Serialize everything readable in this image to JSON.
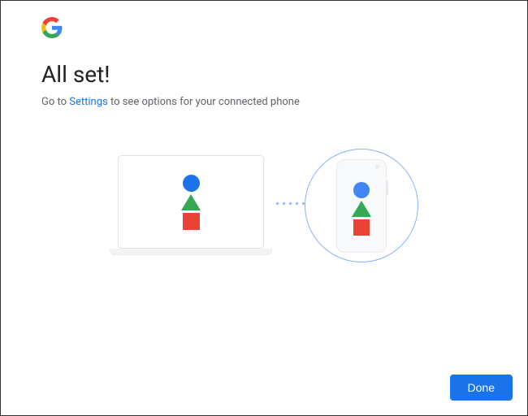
{
  "header": {
    "title": "All set!",
    "subtitle_prefix": "Go to ",
    "subtitle_link": "Settings",
    "subtitle_suffix": " to see options for your connected phone"
  },
  "illustration": {
    "laptop_label": "laptop",
    "phone_label": "phone",
    "shapes": [
      "circle-blue",
      "triangle-green",
      "square-red"
    ],
    "connector": "dotted"
  },
  "actions": {
    "done_label": "Done"
  },
  "colors": {
    "blue": "#1a73e8",
    "green": "#34a853",
    "yellow": "#fbbc05",
    "red": "#ea4335",
    "accent_outline": "#8ab4f8"
  }
}
